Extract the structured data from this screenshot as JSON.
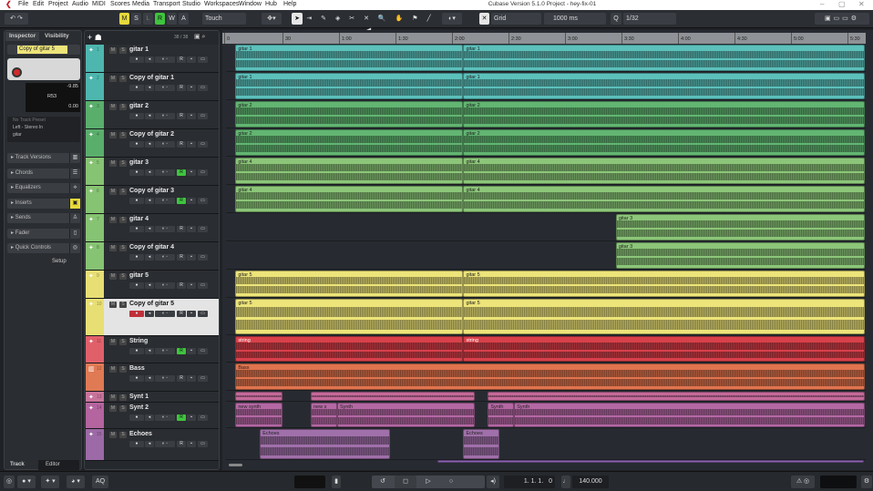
{
  "window": {
    "title": "Cubase Version 5.1.0 Project - hey-fix-01"
  },
  "menu": [
    "File",
    "Edit",
    "Project",
    "Audio",
    "MIDI",
    "Scores",
    "Media",
    "Transport",
    "Studio",
    "Workspaces",
    "Window",
    "Hub",
    "Help"
  ],
  "toolbar": {
    "m": "M",
    "s": "S",
    "l": "L",
    "r": "R",
    "w": "W",
    "a": "A",
    "automation_mode": "Touch",
    "snap_type": "Grid",
    "nudge": "1000 ms",
    "quantize": "1/32"
  },
  "inspector": {
    "tab_inspector": "Inspector",
    "tab_visibility": "Visibility",
    "track_name": "Copy of gitar 5",
    "volume": "-9.85",
    "pan": "R53",
    "delay": "0.00",
    "preset": "No Track Preset",
    "input": "Left - Stereo In",
    "output": "gitar",
    "sections": [
      "Track Versions",
      "Chords",
      "Equalizers",
      "Inserts",
      "Sends",
      "Fader",
      "Quick Controls"
    ],
    "setup": "Setup",
    "tab_track": "Track",
    "tab_editor": "Editor"
  },
  "tracklist": {
    "count": "38 / 38"
  },
  "ruler": [
    "0",
    "30",
    "1:00",
    "1:30",
    "2:00",
    "2:30",
    "3:00",
    "3:30",
    "4:00",
    "4:30",
    "5:00",
    "5:30"
  ],
  "tracks": [
    {
      "num": "1",
      "name": "gitar 1",
      "color": "#4db6ae",
      "ev": "#5cc0bb",
      "rec": false,
      "events": [
        [
          5,
          126,
          "gitar 1"
        ],
        [
          126,
          339,
          "gitar 1"
        ]
      ]
    },
    {
      "num": "2",
      "name": "Copy of gitar 1",
      "color": "#4db6ae",
      "ev": "#5cc0bb",
      "rec": false,
      "events": [
        [
          5,
          126,
          "gitar 1"
        ],
        [
          126,
          339,
          "gitar 1"
        ]
      ]
    },
    {
      "num": "3",
      "name": "gitar 2",
      "color": "#5aae6c",
      "ev": "#62b572",
      "rec": false,
      "events": [
        [
          5,
          126,
          "gitar 2"
        ],
        [
          126,
          339,
          "gitar 2"
        ]
      ]
    },
    {
      "num": "4",
      "name": "Copy of gitar 2",
      "color": "#5aae6c",
      "ev": "#62b572",
      "rec": false,
      "events": [
        [
          5,
          126,
          "gitar 2"
        ],
        [
          126,
          339,
          "gitar 2"
        ]
      ]
    },
    {
      "num": "5",
      "name": "gitar 3",
      "color": "#86c372",
      "ev": "#8cc679",
      "rec": true,
      "events": [
        [
          5,
          126,
          "gitar 4"
        ],
        [
          126,
          339,
          "gitar 4"
        ]
      ]
    },
    {
      "num": "6",
      "name": "Copy of gitar 3",
      "color": "#86c372",
      "ev": "#8cc679",
      "rec": true,
      "events": [
        [
          5,
          126,
          "gitar 4"
        ],
        [
          126,
          339,
          "gitar 4"
        ]
      ]
    },
    {
      "num": "7",
      "name": "gitar 4",
      "color": "#86c372",
      "ev": "#8cc679",
      "rec": false,
      "events": [
        [
          207,
          339,
          "gitar 3"
        ]
      ]
    },
    {
      "num": "8",
      "name": "Copy of gitar 4",
      "color": "#86c372",
      "ev": "#8cc679",
      "rec": false,
      "events": [
        [
          207,
          339,
          "gitar 3"
        ]
      ]
    },
    {
      "num": "9",
      "name": "gitar 5",
      "color": "#e8df74",
      "ev": "#ede47a",
      "rec": false,
      "events": [
        [
          5,
          126,
          "gitar 5"
        ],
        [
          126,
          339,
          "gitar 5"
        ]
      ]
    },
    {
      "num": "10",
      "name": "Copy of gitar 5",
      "color": "#e8df74",
      "ev": "#ede47a",
      "rec": false,
      "selected": true,
      "events": [
        [
          5,
          126,
          "gitar 5"
        ],
        [
          126,
          339,
          "gitar 5"
        ]
      ]
    },
    {
      "num": "11",
      "name": "String",
      "color": "#e0606a",
      "ev": "#d8404a",
      "rec": true,
      "events": [
        [
          5,
          126,
          "string"
        ],
        [
          126,
          339,
          "string"
        ]
      ]
    },
    {
      "num": "12",
      "name": "Bass",
      "color": "#e07a55",
      "ev": "#e0744e",
      "rec": false,
      "events": [
        [
          5,
          339,
          "Bass"
        ]
      ]
    },
    {
      "num": "13",
      "name": "Synt 1",
      "color": "#c8739c",
      "ev": "#c46a9a",
      "rec": false,
      "events": [
        [
          5,
          30,
          ""
        ],
        [
          45,
          132,
          ""
        ],
        [
          139,
          339,
          ""
        ]
      ]
    },
    {
      "num": "14",
      "name": "Synt 2",
      "color": "#b4649e",
      "ev": "#b468a4",
      "rec": true,
      "events": [
        [
          5,
          30,
          "new synth"
        ],
        [
          45,
          59,
          "new s"
        ],
        [
          59,
          132,
          "Synth"
        ],
        [
          139,
          153,
          "Synth"
        ],
        [
          153,
          339,
          "Synth"
        ]
      ]
    },
    {
      "num": "15",
      "name": "Echoes",
      "color": "#9c6aa6",
      "ev": "#a070aa",
      "rec": false,
      "events": [
        [
          18,
          87,
          "Echoes"
        ],
        [
          126,
          145,
          "Echoes"
        ]
      ]
    }
  ],
  "transport": {
    "position": "1. 1. 1.   0",
    "tempo": "140.000",
    "aq": "AQ"
  }
}
